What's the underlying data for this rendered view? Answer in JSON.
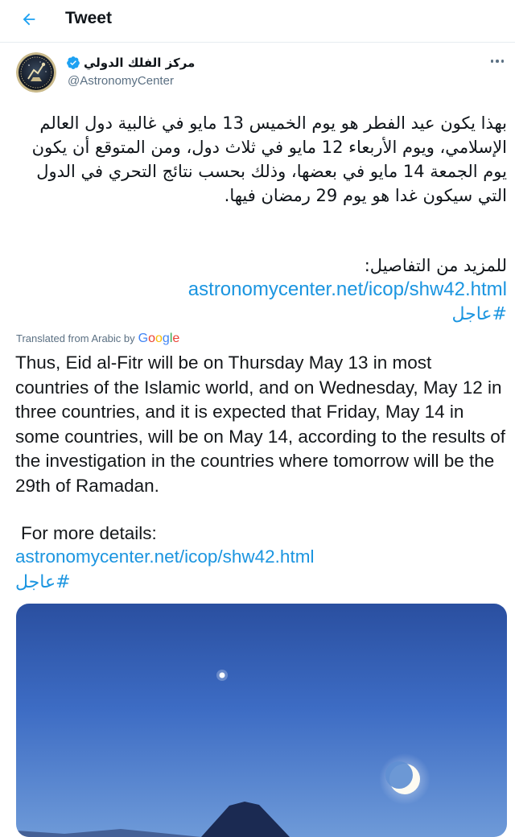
{
  "header": {
    "title": "Tweet",
    "back_icon": "arrow-left-icon"
  },
  "author": {
    "name": "مركز الفلك الدولي",
    "handle": "@AstronomyCenter",
    "verified_icon": "verified-badge-icon",
    "avatar_icon": "observatory-logo-icon"
  },
  "tweet": {
    "arabic_body": "بهذا يكون عيد الفطر هو يوم الخميس 13 مايو في غالبية دول العالم الإسلامي، ويوم الأربعاء 12 مايو في ثلاث دول، ومن المتوقع أن يكون يوم الجمعة 14 مايو في بعضها، وذلك بحسب نتائج التحري في الدول التي سيكون غدا هو يوم 29 رمضان فيها.",
    "arabic_more": "للمزيد من التفاصيل:",
    "link": "astronomycenter.net/icop/shw42.html",
    "hashtag": "#عاجل",
    "translated_from": "Translated from Arabic by",
    "translator": "Google",
    "english_body": "Thus, Eid al-Fitr will be on Thursday May 13 in most countries of the Islamic world, and on Wednesday, May 12 in three countries, and it is expected that Friday, May 14 in some countries, will be on May 14, according to the results of the investigation in the countries where tomorrow will be the 29th of Ramadan.",
    "english_more": "For more details:",
    "english_link": "astronomycenter.net/icop/shw42.html",
    "english_hashtag": "#عاجل"
  },
  "colors": {
    "accent": "#1da1f2",
    "link": "#1b95e0",
    "secondary_text": "#5b7083",
    "divider": "#e6ecf0"
  },
  "media": {
    "icon": "night-sky-crescent-moon-image"
  }
}
